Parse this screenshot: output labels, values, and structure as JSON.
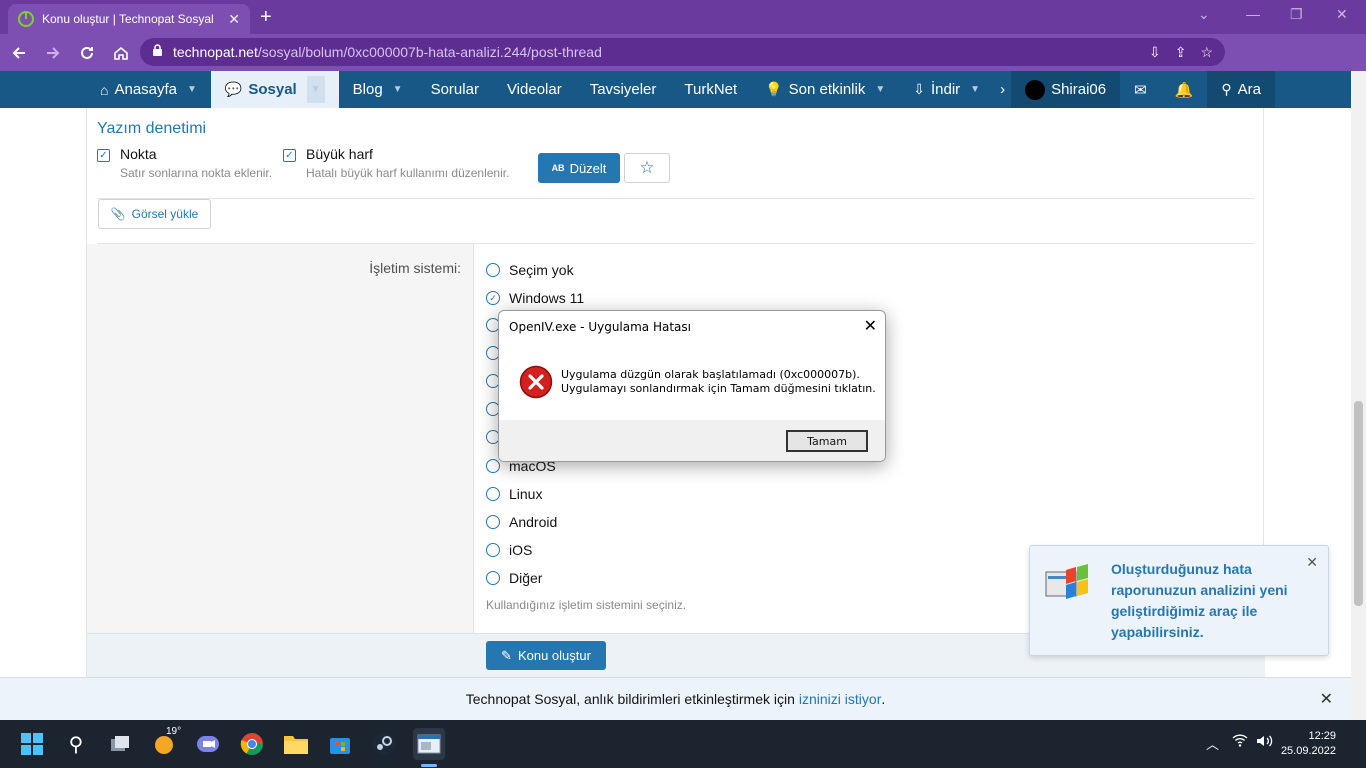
{
  "browser": {
    "tab_title": "Konu oluştur | Technopat Sosyal",
    "tab_close": "✕",
    "new_tab": "+",
    "url_host": "technopat.net",
    "url_path": "/sosyal/bolum/0xc000007b-hata-analizi.244/post-thread"
  },
  "sitenav": {
    "items": [
      {
        "label": "Anasayfa"
      },
      {
        "label": "Sosyal"
      },
      {
        "label": "Blog"
      },
      {
        "label": "Sorular"
      },
      {
        "label": "Videolar"
      },
      {
        "label": "Tavsiyeler"
      },
      {
        "label": "TurkNet"
      },
      {
        "label": "Son etkinlik"
      },
      {
        "label": "İndir"
      }
    ],
    "username": "Shirai06",
    "search_label": "Ara"
  },
  "editor": {
    "section_title": "Yazım denetimi",
    "option1_label": "Nokta",
    "option1_hint": "Satır sonlarına nokta eklenir.",
    "option2_label": "Büyük harf",
    "option2_hint": "Hatalı büyük harf kullanımı düzenlenir.",
    "fix_badge": "AB",
    "fix_button": "Düzelt",
    "upload_button": "Görsel yükle"
  },
  "os_field": {
    "label": "İşletim sistemi:",
    "options": [
      "Seçim yok",
      "Windows 11",
      "macOS",
      "Linux",
      "Android",
      "iOS",
      "Diğer"
    ],
    "selected": "Windows 11",
    "hint": "Kullandığınız işletim sistemini seçiniz."
  },
  "submit_button": "Konu oluştur",
  "dialog": {
    "title": "OpenIV.exe - Uygulama Hatası",
    "message_line1": "Uygulama düzgün olarak başlatılamadı (0xc000007b).",
    "message_line2": "Uygulamayı sonlandırmak için Tamam düğmesini tıklatın.",
    "ok_button": "Tamam"
  },
  "toast": {
    "text": "Oluşturduğunuz hata raporunuzun analizini yeni geliştirdiğimiz araç ile yapabilirsiniz."
  },
  "permission_bar": {
    "text": "Technopat Sosyal, anlık bildirimleri etkinleştirmek için",
    "link": "izninizi istiyor",
    "suffix": "."
  },
  "taskbar": {
    "weather_temp": "19°",
    "time": "12:29",
    "date": "25.09.2022"
  },
  "colors": {
    "browser_accent": "#7e4fb3",
    "site_nav": "#185886",
    "link_blue": "#2577b1"
  }
}
